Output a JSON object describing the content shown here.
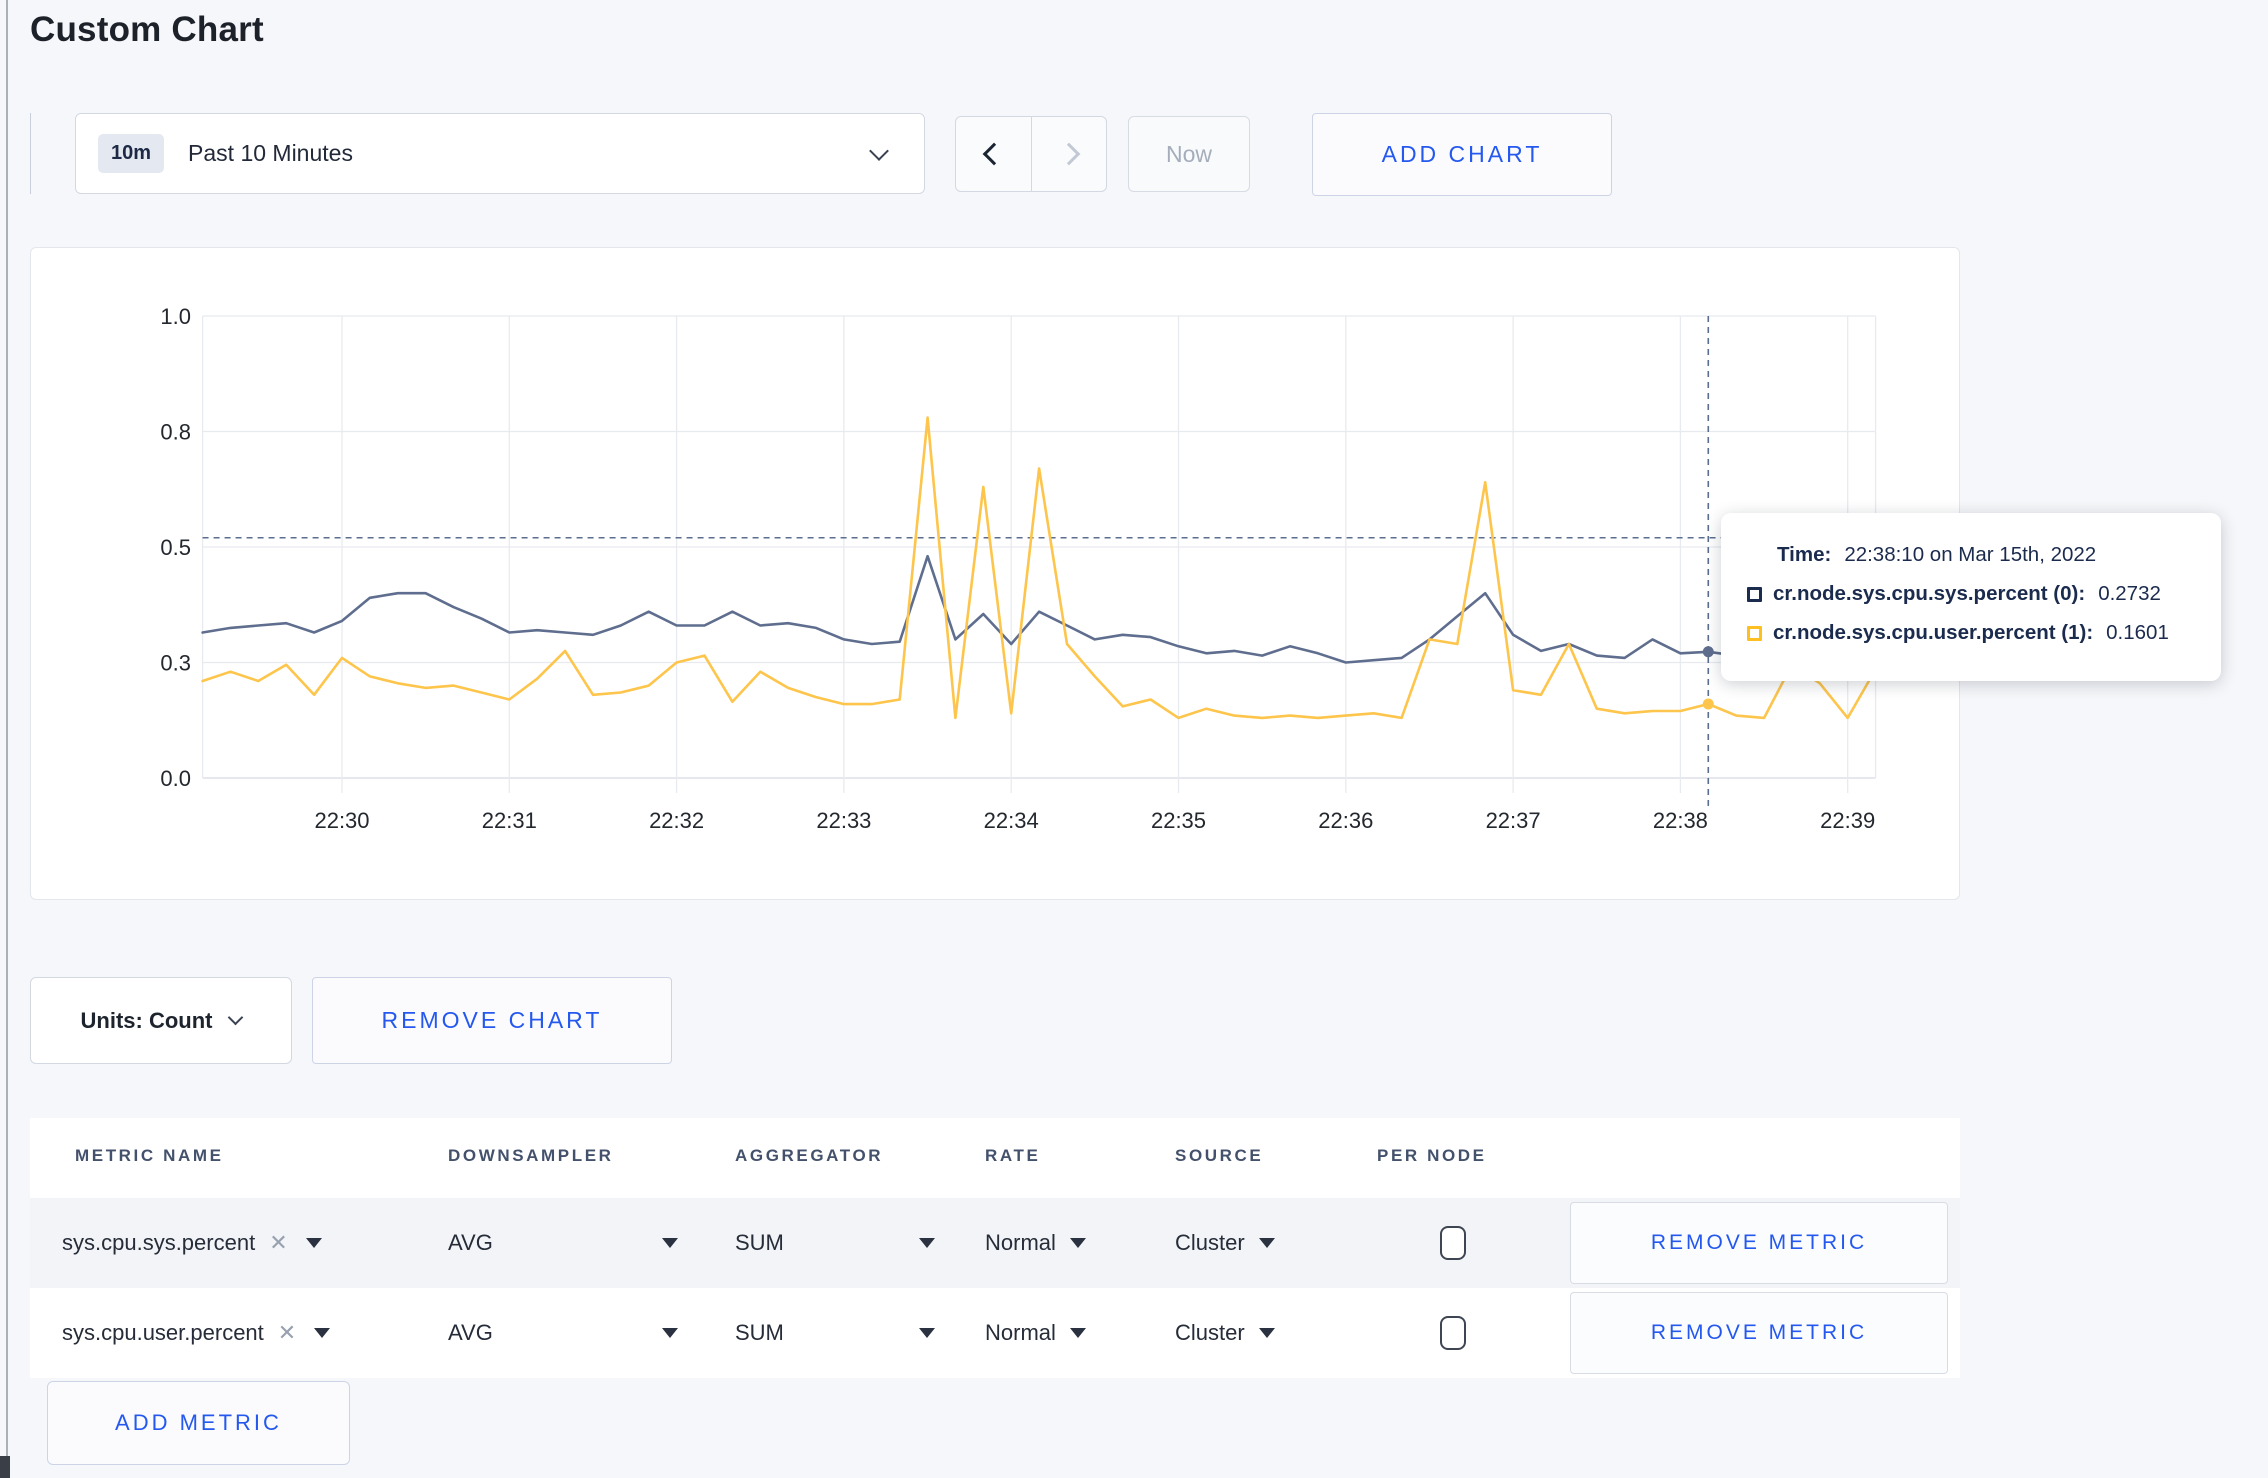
{
  "page": {
    "title": "Custom Chart"
  },
  "toolbar": {
    "range_badge": "10m",
    "range_label": "Past 10 Minutes",
    "prev_label": "previous time window",
    "next_label": "next time window",
    "now_label": "Now",
    "add_chart_label": "ADD CHART"
  },
  "chart_data": {
    "type": "line",
    "title": "",
    "xlabel": "",
    "ylabel": "",
    "ylim": [
      0,
      1
    ],
    "grid": true,
    "legend_position": "tooltip",
    "x_start": "22:29:10",
    "sample_interval_s": 10,
    "t0_s": -50,
    "y_ticks": [
      {
        "value": 0,
        "label": "0.0"
      },
      {
        "value": 0.25,
        "label": "0.3"
      },
      {
        "value": 0.5,
        "label": "0.5"
      },
      {
        "value": 0.75,
        "label": "0.8"
      },
      {
        "value": 1,
        "label": "1.0"
      }
    ],
    "x_ticks": [
      {
        "t_s": 0,
        "label": "22:30"
      },
      {
        "t_s": 60,
        "label": "22:31"
      },
      {
        "t_s": 120,
        "label": "22:32"
      },
      {
        "t_s": 180,
        "label": "22:33"
      },
      {
        "t_s": 240,
        "label": "22:34"
      },
      {
        "t_s": 300,
        "label": "22:35"
      },
      {
        "t_s": 360,
        "label": "22:36"
      },
      {
        "t_s": 420,
        "label": "22:37"
      },
      {
        "t_s": 480,
        "label": "22:38"
      },
      {
        "t_s": 540,
        "label": "22:39"
      }
    ],
    "series": [
      {
        "name": "cr.node.sys.cpu.sys.percent (0)",
        "color": "#5f6e8e",
        "values": [
          0.315,
          0.325,
          0.33,
          0.335,
          0.315,
          0.34,
          0.39,
          0.4,
          0.4,
          0.37,
          0.345,
          0.315,
          0.32,
          0.315,
          0.31,
          0.33,
          0.36,
          0.33,
          0.33,
          0.36,
          0.33,
          0.335,
          0.325,
          0.3,
          0.29,
          0.295,
          0.48,
          0.3,
          0.355,
          0.29,
          0.36,
          0.33,
          0.3,
          0.31,
          0.305,
          0.285,
          0.27,
          0.275,
          0.265,
          0.285,
          0.27,
          0.25,
          0.255,
          0.26,
          0.3,
          0.35,
          0.4,
          0.31,
          0.275,
          0.29,
          0.265,
          0.26,
          0.3,
          0.27,
          0.2732,
          0.265,
          0.285,
          0.27,
          0.265,
          0.27,
          0.285
        ]
      },
      {
        "name": "cr.node.sys.cpu.user.percent (1)",
        "color": "#fdc54b",
        "values": [
          0.21,
          0.23,
          0.21,
          0.245,
          0.18,
          0.26,
          0.22,
          0.205,
          0.195,
          0.2,
          0.185,
          0.17,
          0.215,
          0.275,
          0.18,
          0.185,
          0.2,
          0.25,
          0.265,
          0.165,
          0.23,
          0.195,
          0.175,
          0.16,
          0.16,
          0.17,
          0.78,
          0.13,
          0.63,
          0.14,
          0.67,
          0.29,
          0.22,
          0.155,
          0.17,
          0.13,
          0.15,
          0.135,
          0.13,
          0.135,
          0.13,
          0.135,
          0.14,
          0.13,
          0.3,
          0.29,
          0.64,
          0.19,
          0.18,
          0.29,
          0.15,
          0.14,
          0.145,
          0.145,
          0.1601,
          0.135,
          0.13,
          0.245,
          0.205,
          0.13,
          0.235
        ]
      }
    ],
    "crosshair": {
      "t_s": 490,
      "hline_value": 0.52,
      "dot_values": [
        0.2732,
        0.1601
      ]
    }
  },
  "tooltip": {
    "time_label": "Time:",
    "time_value": "22:38:10 on Mar 15th, 2022",
    "rows": [
      {
        "name": "cr.node.sys.cpu.sys.percent (0):",
        "value": "0.2732",
        "color": "#1c2c4e"
      },
      {
        "name": "cr.node.sys.cpu.user.percent (1):",
        "value": "0.1601",
        "color": "#fdc020"
      }
    ]
  },
  "chart_controls": {
    "units_label": "Units: Count",
    "remove_chart_label": "REMOVE CHART"
  },
  "metrics_table": {
    "headers": [
      "METRIC NAME",
      "DOWNSAMPLER",
      "AGGREGATOR",
      "RATE",
      "SOURCE",
      "PER NODE"
    ],
    "rows": [
      {
        "metric": "sys.cpu.sys.percent",
        "downsampler": "AVG",
        "aggregator": "SUM",
        "rate": "Normal",
        "source": "Cluster",
        "per_node_checked": false,
        "remove_label": "REMOVE METRIC"
      },
      {
        "metric": "sys.cpu.user.percent",
        "downsampler": "AVG",
        "aggregator": "SUM",
        "rate": "Normal",
        "source": "Cluster",
        "per_node_checked": false,
        "remove_label": "REMOVE METRIC"
      }
    ],
    "add_metric_label": "ADD METRIC"
  }
}
